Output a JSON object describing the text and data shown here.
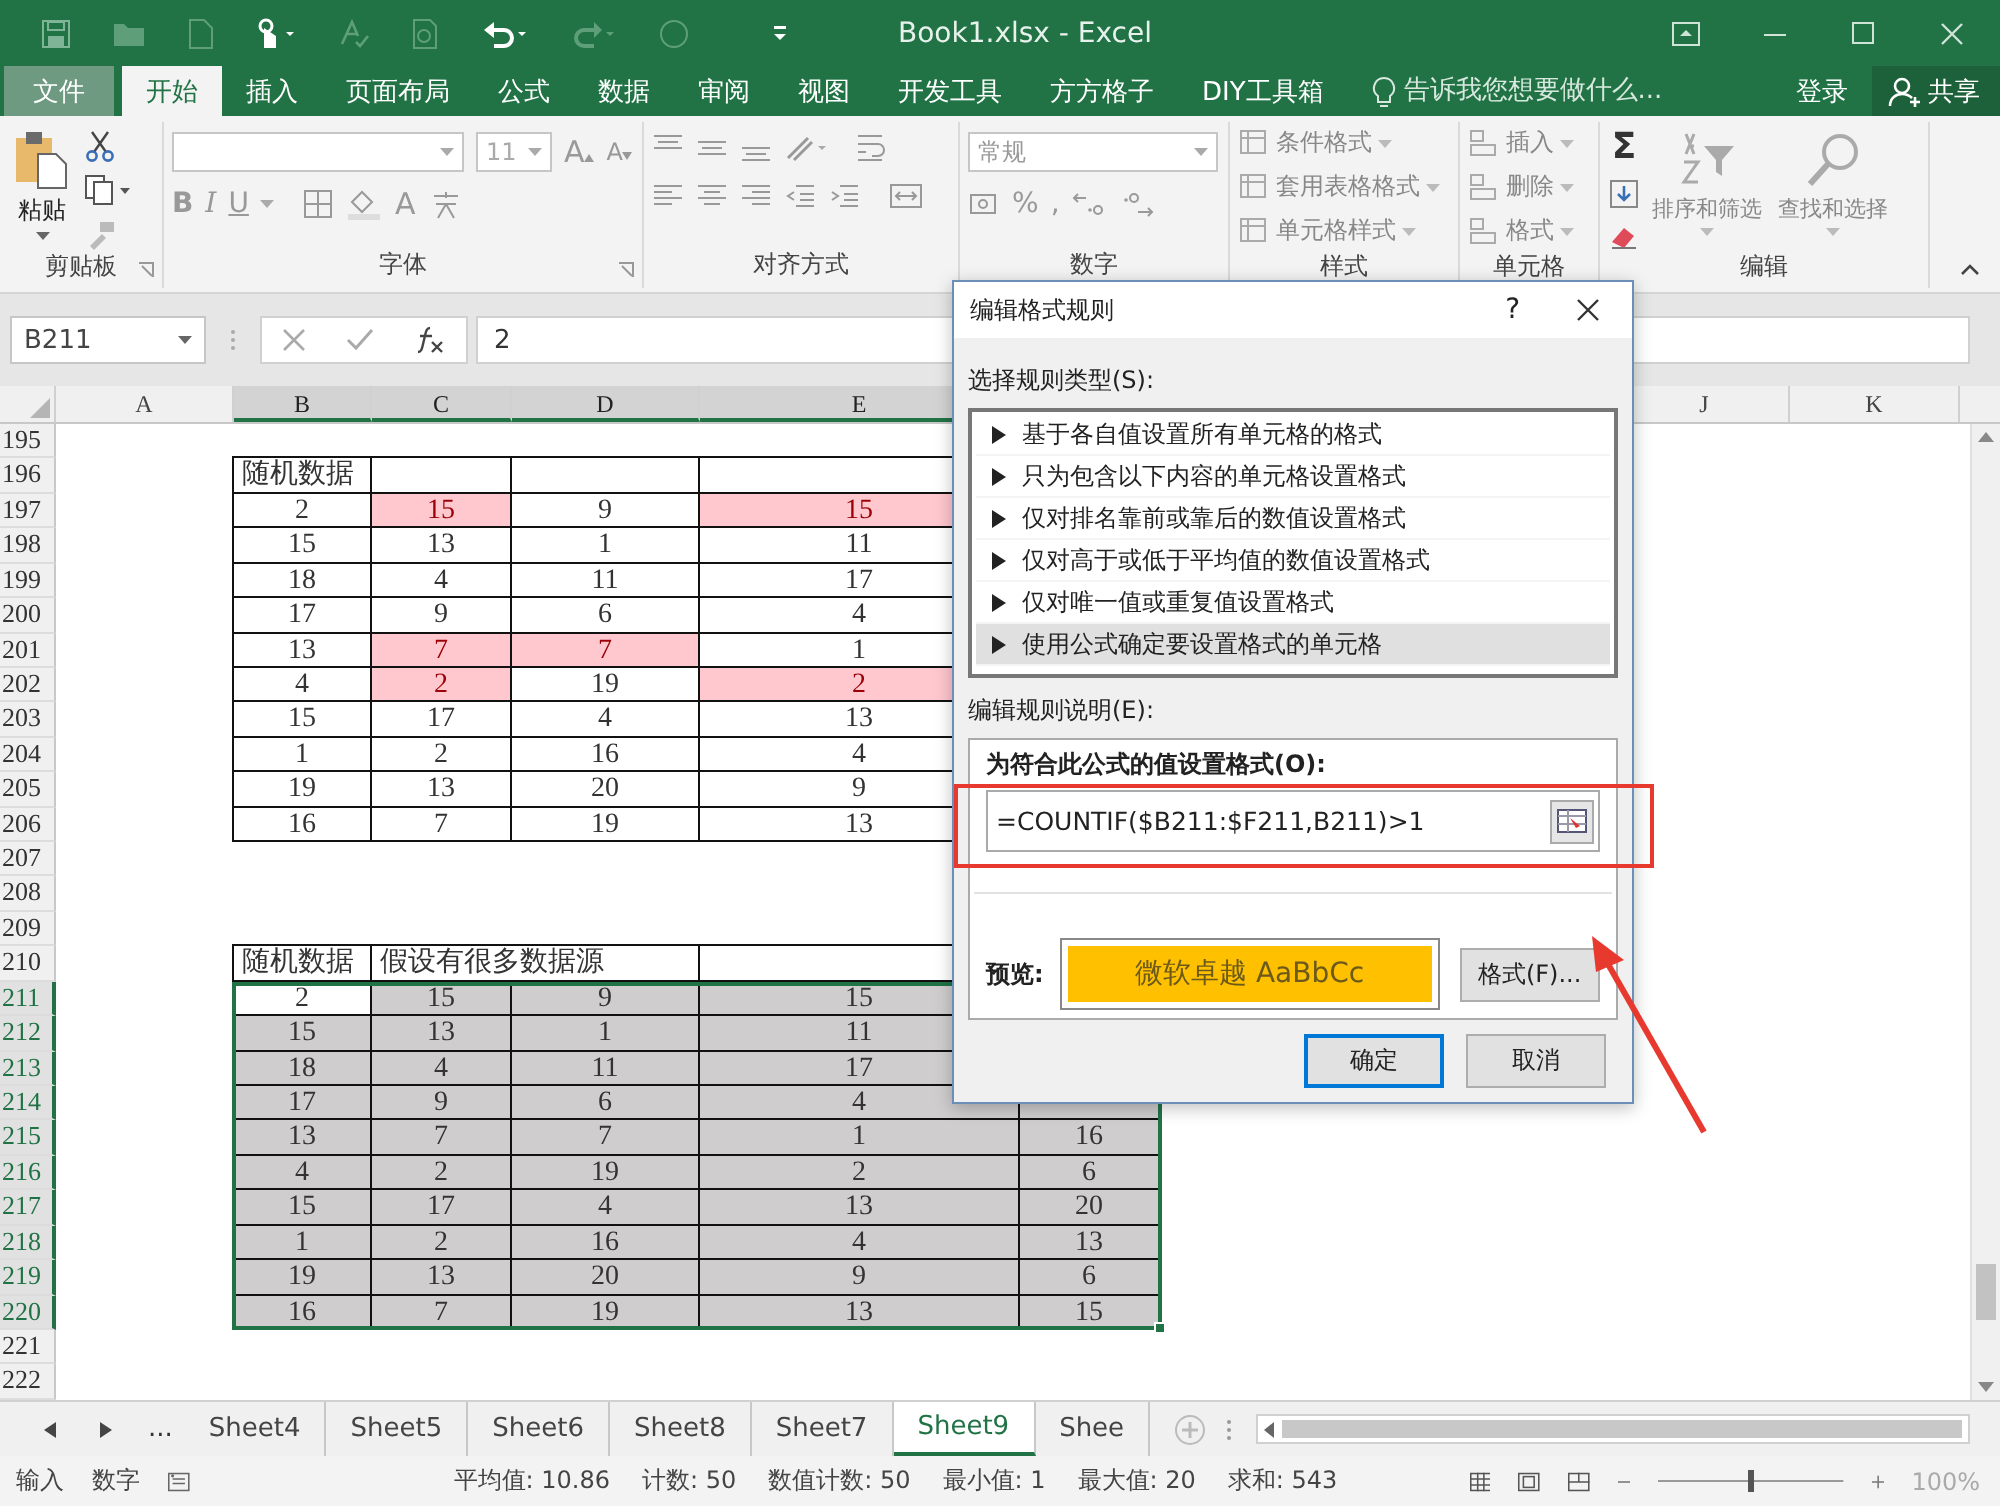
{
  "window": {
    "title": "Book1.xlsx - Excel"
  },
  "ribbon_tabs": [
    {
      "label": "文件",
      "kind": "file",
      "selected": false
    },
    {
      "label": "开始",
      "kind": "tab",
      "selected": true
    },
    {
      "label": "插入",
      "kind": "tab",
      "selected": false
    },
    {
      "label": "页面布局",
      "kind": "tab",
      "selected": false
    },
    {
      "label": "公式",
      "kind": "tab",
      "selected": false
    },
    {
      "label": "数据",
      "kind": "tab",
      "selected": false
    },
    {
      "label": "审阅",
      "kind": "tab",
      "selected": false
    },
    {
      "label": "视图",
      "kind": "tab",
      "selected": false
    },
    {
      "label": "开发工具",
      "kind": "tab",
      "selected": false
    },
    {
      "label": "方方格子",
      "kind": "tab",
      "selected": false
    },
    {
      "label": "DIY工具箱",
      "kind": "tab",
      "selected": false
    }
  ],
  "tell_me": {
    "placeholder": "告诉我您想要做什么..."
  },
  "account": {
    "sign_in": "登录",
    "share": "共享"
  },
  "ribbon": {
    "clipboard": {
      "label": "剪贴板",
      "paste": "粘贴"
    },
    "font": {
      "label": "字体",
      "size": "11",
      "grow": "A",
      "shrink": "A",
      "bold": "B",
      "italic": "I",
      "underline": "U",
      "font_color": "A"
    },
    "alignment": {
      "label": "对齐方式"
    },
    "number": {
      "label": "数字",
      "format": "常规",
      "percent": "%",
      "comma": ","
    },
    "styles": {
      "label": "样式",
      "items": [
        "条件格式",
        "套用表格格式",
        "单元格样式"
      ]
    },
    "cells": {
      "label": "单元格",
      "items": [
        "插入",
        "删除",
        "格式"
      ]
    },
    "editing": {
      "label": "编辑",
      "autosum": "Σ",
      "sort": "排序和筛选",
      "find": "查找和选择"
    }
  },
  "formula_bar": {
    "name_box": "B211",
    "formula": "2"
  },
  "sheet": {
    "columns": [
      {
        "label": "A",
        "selected": false
      },
      {
        "label": "B",
        "selected": true
      },
      {
        "label": "C",
        "selected": true
      },
      {
        "label": "D",
        "selected": true
      },
      {
        "label": "E",
        "selected": true
      }
    ],
    "far_columns": [
      {
        "label": "J",
        "selected": false
      },
      {
        "label": "K",
        "selected": false
      }
    ],
    "rows": [
      {
        "number": "195",
        "selected": false,
        "cells": []
      },
      {
        "number": "196",
        "selected": false,
        "cells": [
          {
            "kind": "empty"
          },
          {
            "text": "随机数据",
            "kind": "label"
          },
          {
            "kind": "plain"
          },
          {
            "kind": "plain"
          },
          {
            "kind": "plain"
          }
        ]
      },
      {
        "number": "197",
        "selected": false,
        "cells": [
          {
            "kind": "empty"
          },
          {
            "text": "2",
            "kind": "plain"
          },
          {
            "text": "15",
            "kind": "highlighted"
          },
          {
            "text": "9",
            "kind": "plain"
          },
          {
            "text": "15",
            "kind": "highlighted"
          }
        ]
      },
      {
        "number": "198",
        "selected": false,
        "cells": [
          {
            "kind": "empty"
          },
          {
            "text": "15",
            "kind": "plain"
          },
          {
            "text": "13",
            "kind": "plain"
          },
          {
            "text": "1",
            "kind": "plain"
          },
          {
            "text": "11",
            "kind": "plain"
          }
        ]
      },
      {
        "number": "199",
        "selected": false,
        "cells": [
          {
            "kind": "empty"
          },
          {
            "text": "18",
            "kind": "plain"
          },
          {
            "text": "4",
            "kind": "plain"
          },
          {
            "text": "11",
            "kind": "plain"
          },
          {
            "text": "17",
            "kind": "plain"
          }
        ]
      },
      {
        "number": "200",
        "selected": false,
        "cells": [
          {
            "kind": "empty"
          },
          {
            "text": "17",
            "kind": "plain"
          },
          {
            "text": "9",
            "kind": "plain"
          },
          {
            "text": "6",
            "kind": "plain"
          },
          {
            "text": "4",
            "kind": "plain"
          }
        ]
      },
      {
        "number": "201",
        "selected": false,
        "cells": [
          {
            "kind": "empty"
          },
          {
            "text": "13",
            "kind": "plain"
          },
          {
            "text": "7",
            "kind": "highlighted"
          },
          {
            "text": "7",
            "kind": "highlighted"
          },
          {
            "text": "1",
            "kind": "plain"
          }
        ]
      },
      {
        "number": "202",
        "selected": false,
        "cells": [
          {
            "kind": "empty"
          },
          {
            "text": "4",
            "kind": "plain"
          },
          {
            "text": "2",
            "kind": "highlighted"
          },
          {
            "text": "19",
            "kind": "plain"
          },
          {
            "text": "2",
            "kind": "highlighted"
          }
        ]
      },
      {
        "number": "203",
        "selected": false,
        "cells": [
          {
            "kind": "empty"
          },
          {
            "text": "15",
            "kind": "plain"
          },
          {
            "text": "17",
            "kind": "plain"
          },
          {
            "text": "4",
            "kind": "plain"
          },
          {
            "text": "13",
            "kind": "plain"
          }
        ]
      },
      {
        "number": "204",
        "selected": false,
        "cells": [
          {
            "kind": "empty"
          },
          {
            "text": "1",
            "kind": "plain"
          },
          {
            "text": "2",
            "kind": "plain"
          },
          {
            "text": "16",
            "kind": "plain"
          },
          {
            "text": "4",
            "kind": "plain"
          }
        ]
      },
      {
        "number": "205",
        "selected": false,
        "cells": [
          {
            "kind": "empty"
          },
          {
            "text": "19",
            "kind": "plain"
          },
          {
            "text": "13",
            "kind": "plain"
          },
          {
            "text": "20",
            "kind": "plain"
          },
          {
            "text": "9",
            "kind": "plain"
          }
        ]
      },
      {
        "number": "206",
        "selected": false,
        "cells": [
          {
            "kind": "empty"
          },
          {
            "text": "16",
            "kind": "plain"
          },
          {
            "text": "7",
            "kind": "plain"
          },
          {
            "text": "19",
            "kind": "plain"
          },
          {
            "text": "13",
            "kind": "plain"
          }
        ]
      },
      {
        "number": "207",
        "selected": false,
        "cells": []
      },
      {
        "number": "208",
        "selected": false,
        "cells": []
      },
      {
        "number": "209",
        "selected": false,
        "cells": []
      },
      {
        "number": "210",
        "selected": false,
        "cells": [
          {
            "kind": "empty"
          },
          {
            "text": "随机数据",
            "kind": "label"
          },
          {
            "text": "假设有很多数据源",
            "kind": "label"
          },
          {
            "kind": "continued"
          },
          {
            "kind": "plain"
          }
        ]
      },
      {
        "number": "211",
        "selected": true,
        "cells": [
          {
            "kind": "empty"
          },
          {
            "text": "2",
            "kind": "active"
          },
          {
            "text": "15",
            "kind": "shaded"
          },
          {
            "text": "9",
            "kind": "shaded"
          },
          {
            "text": "15",
            "kind": "shaded"
          }
        ]
      },
      {
        "number": "212",
        "selected": true,
        "cells": [
          {
            "kind": "empty"
          },
          {
            "text": "15",
            "kind": "shaded"
          },
          {
            "text": "13",
            "kind": "shaded"
          },
          {
            "text": "1",
            "kind": "shaded"
          },
          {
            "text": "11",
            "kind": "shaded"
          }
        ]
      },
      {
        "number": "213",
        "selected": true,
        "cells": [
          {
            "kind": "empty"
          },
          {
            "text": "18",
            "kind": "shaded"
          },
          {
            "text": "4",
            "kind": "shaded"
          },
          {
            "text": "11",
            "kind": "shaded"
          },
          {
            "text": "17",
            "kind": "shaded"
          }
        ]
      },
      {
        "number": "214",
        "selected": true,
        "cells": [
          {
            "kind": "empty"
          },
          {
            "text": "17",
            "kind": "shaded"
          },
          {
            "text": "9",
            "kind": "shaded"
          },
          {
            "text": "6",
            "kind": "shaded"
          },
          {
            "text": "4",
            "kind": "shaded"
          },
          {
            "kind": "shaded"
          }
        ]
      },
      {
        "number": "215",
        "selected": true,
        "cells": [
          {
            "kind": "empty"
          },
          {
            "text": "13",
            "kind": "shaded"
          },
          {
            "text": "7",
            "kind": "shaded"
          },
          {
            "text": "7",
            "kind": "shaded"
          },
          {
            "text": "1",
            "kind": "shaded"
          },
          {
            "text": "16",
            "kind": "shaded"
          }
        ]
      },
      {
        "number": "216",
        "selected": true,
        "cells": [
          {
            "kind": "empty"
          },
          {
            "text": "4",
            "kind": "shaded"
          },
          {
            "text": "2",
            "kind": "shaded"
          },
          {
            "text": "19",
            "kind": "shaded"
          },
          {
            "text": "2",
            "kind": "shaded"
          },
          {
            "text": "6",
            "kind": "shaded"
          }
        ]
      },
      {
        "number": "217",
        "selected": true,
        "cells": [
          {
            "kind": "empty"
          },
          {
            "text": "15",
            "kind": "shaded"
          },
          {
            "text": "17",
            "kind": "shaded"
          },
          {
            "text": "4",
            "kind": "shaded"
          },
          {
            "text": "13",
            "kind": "shaded"
          },
          {
            "text": "20",
            "kind": "shaded"
          }
        ]
      },
      {
        "number": "218",
        "selected": true,
        "cells": [
          {
            "kind": "empty"
          },
          {
            "text": "1",
            "kind": "shaded"
          },
          {
            "text": "2",
            "kind": "shaded"
          },
          {
            "text": "16",
            "kind": "shaded"
          },
          {
            "text": "4",
            "kind": "shaded"
          },
          {
            "text": "13",
            "kind": "shaded"
          }
        ]
      },
      {
        "number": "219",
        "selected": true,
        "cells": [
          {
            "kind": "empty"
          },
          {
            "text": "19",
            "kind": "shaded"
          },
          {
            "text": "13",
            "kind": "shaded"
          },
          {
            "text": "20",
            "kind": "shaded"
          },
          {
            "text": "9",
            "kind": "shaded"
          },
          {
            "text": "6",
            "kind": "shaded"
          }
        ]
      },
      {
        "number": "220",
        "selected": true,
        "cells": [
          {
            "kind": "empty"
          },
          {
            "text": "16",
            "kind": "shaded"
          },
          {
            "text": "7",
            "kind": "shaded"
          },
          {
            "text": "19",
            "kind": "shaded"
          },
          {
            "text": "13",
            "kind": "shaded"
          },
          {
            "text": "15",
            "kind": "shaded"
          }
        ]
      },
      {
        "number": "221",
        "selected": false,
        "cells": []
      },
      {
        "number": "222",
        "selected": false,
        "cells": []
      }
    ]
  },
  "dialog": {
    "title": "编辑格式规则",
    "help": "?",
    "rule_type_label": "选择规则类型(S):",
    "rule_types": [
      {
        "label": "基于各自值设置所有单元格的格式",
        "selected": false
      },
      {
        "label": "只为包含以下内容的单元格设置格式",
        "selected": false
      },
      {
        "label": "仅对排名靠前或靠后的数值设置格式",
        "selected": false
      },
      {
        "label": "仅对高于或低于平均值的数值设置格式",
        "selected": false
      },
      {
        "label": "仅对唯一值或重复值设置格式",
        "selected": false
      },
      {
        "label": "使用公式确定要设置格式的单元格",
        "selected": true
      }
    ],
    "description_label": "编辑规则说明(E):",
    "formula_label": "为符合此公式的值设置格式(O):",
    "formula": "=COUNTIF($B211:$F211,B211)>1",
    "preview_label": "预览:",
    "preview_text": "微软卓越  AaBbCc",
    "format_button": "格式(F)...",
    "ok": "确定",
    "cancel": "取消"
  },
  "sheet_tabs": {
    "more": "...",
    "tabs": [
      {
        "label": "Sheet4",
        "selected": false
      },
      {
        "label": "Sheet5",
        "selected": false
      },
      {
        "label": "Sheet6",
        "selected": false
      },
      {
        "label": "Sheet8",
        "selected": false
      },
      {
        "label": "Sheet7",
        "selected": false
      },
      {
        "label": "Sheet9",
        "selected": true
      },
      {
        "label": "Shee",
        "selected": false
      }
    ]
  },
  "status_bar": {
    "mode": "输入",
    "num": "数字",
    "stats": [
      "平均值: 10.86",
      "计数: 50",
      "数值计数: 50",
      "最小值: 1",
      "最大值: 20",
      "求和: 543"
    ],
    "zoom": {
      "level": 0.5,
      "reading": "100%"
    }
  }
}
